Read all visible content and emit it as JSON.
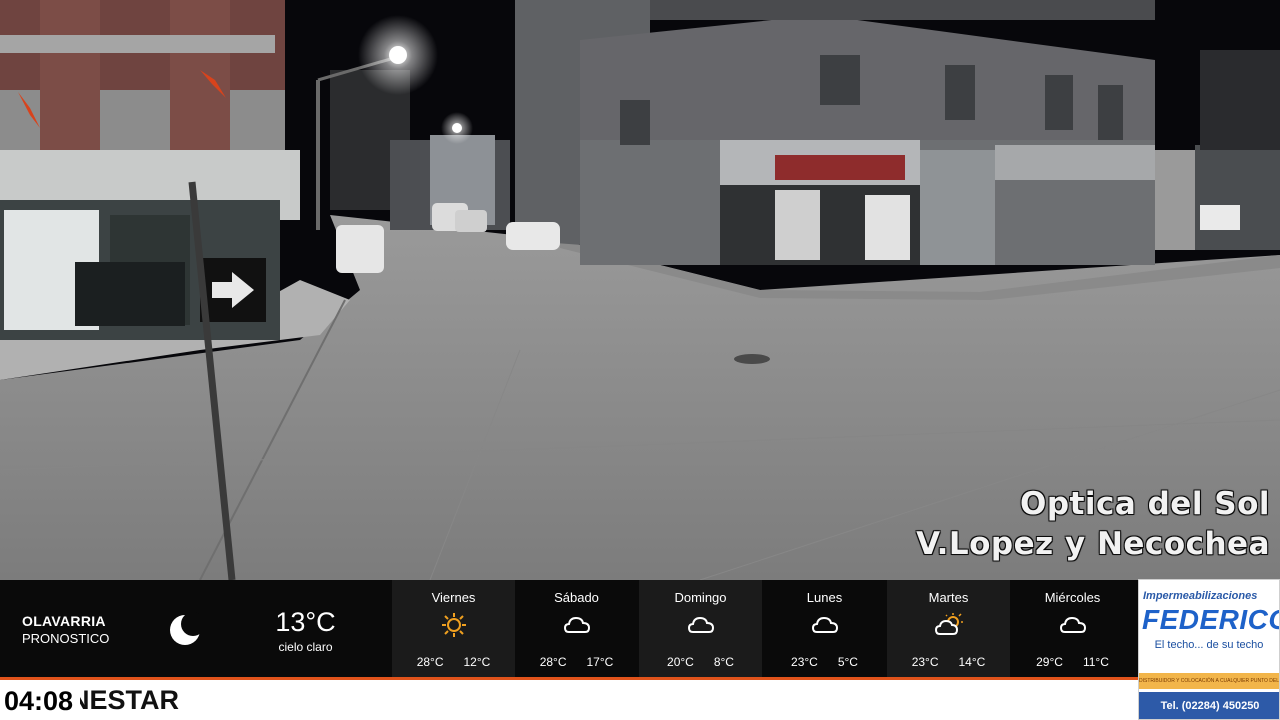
{
  "camera": {
    "overlay_line1": "Optica del Sol",
    "overlay_line2": "V.Lopez y Necochea"
  },
  "weather": {
    "city": "OLAVARRIA",
    "subtitle": "PRONOSTICO",
    "current": {
      "icon": "moon-icon",
      "temp": "13°C",
      "condition": "cielo claro"
    },
    "days": [
      {
        "name": "Viernes",
        "icon": "sun-icon",
        "max": "28°C",
        "min": "12°C"
      },
      {
        "name": "Sábado",
        "icon": "cloud-icon",
        "max": "28°C",
        "min": "17°C"
      },
      {
        "name": "Domingo",
        "icon": "cloud-icon",
        "max": "20°C",
        "min": "8°C"
      },
      {
        "name": "Lunes",
        "icon": "cloud-icon",
        "max": "23°C",
        "min": "5°C"
      },
      {
        "name": "Martes",
        "icon": "sun-cloud-icon",
        "max": "23°C",
        "min": "14°C"
      },
      {
        "name": "Miércoles",
        "icon": "cloud-icon",
        "max": "29°C",
        "min": "11°C"
      }
    ]
  },
  "ticker": {
    "clock": "04:08",
    "text": "NESTAR"
  },
  "ad": {
    "top": "Impermeabilizaciones",
    "brand": "FEDERICO",
    "slogan": "El techo... de su techo",
    "small": "DISTRIBUIDOR Y COLOCACIÓN A CUALQUIER PUNTO DEL PAIS",
    "phone": "Tel. (02284) 450250"
  },
  "colors": {
    "accent": "#e0531b",
    "ad_blue": "#1e62c9",
    "bar_bg": "#0a0a0a"
  }
}
